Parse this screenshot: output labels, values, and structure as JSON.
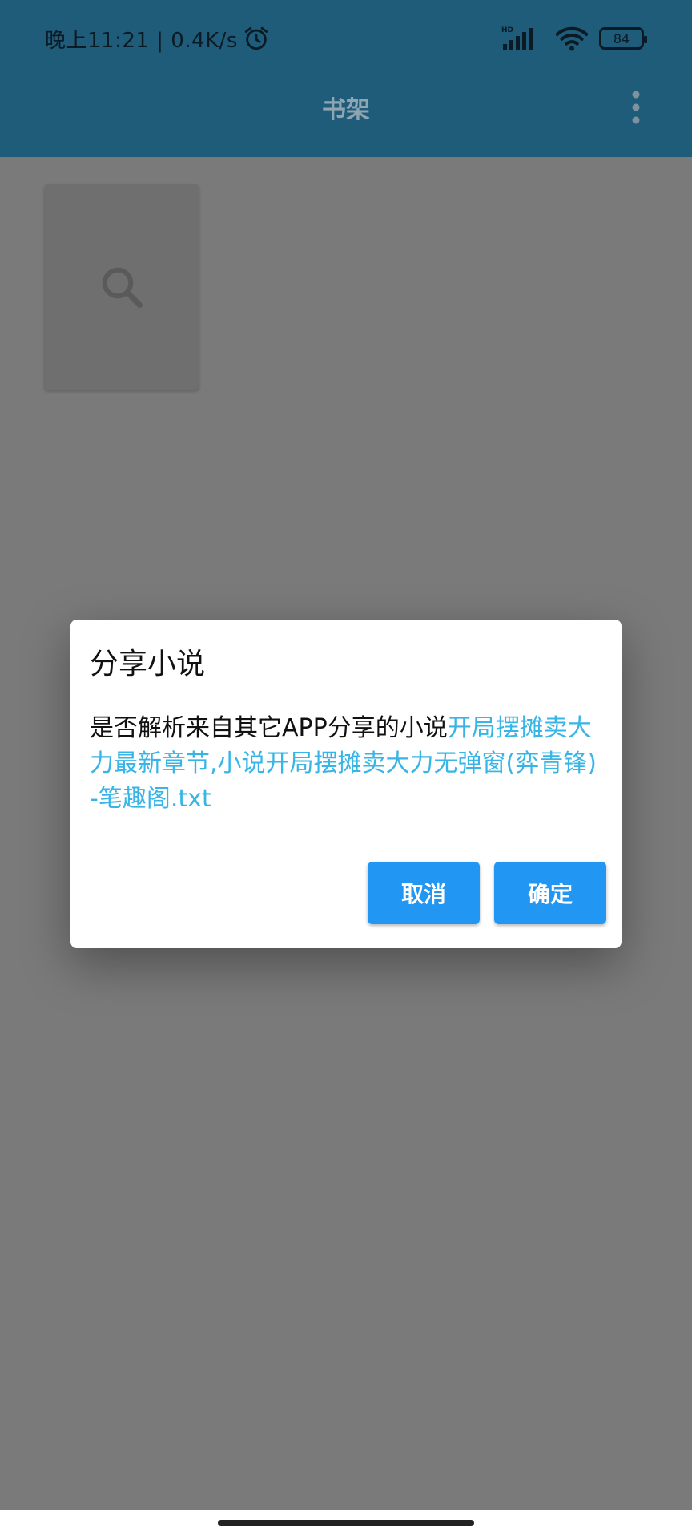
{
  "status_bar": {
    "time_speed": "晚上11:21 | 0.4K/s",
    "battery_level": "84",
    "icons": [
      "alarm-icon",
      "hd-signal-icon",
      "wifi-icon",
      "battery-icon"
    ]
  },
  "app_bar": {
    "title": "书架",
    "menu_icon": "more-vert-icon"
  },
  "bookshelf": {
    "items": [
      {
        "type": "search-placeholder",
        "icon": "search-icon"
      }
    ]
  },
  "dialog": {
    "title": "分享小说",
    "message_prefix": "是否解析来自其它APP分享的小说",
    "message_highlight": "开局摆摊卖大力最新章节,小说开局摆摊卖大力无弹窗(弈青锋)-笔趣阁.txt",
    "cancel_label": "取消",
    "confirm_label": "确定"
  },
  "colors": {
    "appbar_dimmed": "#1f5c7a",
    "scrim_background": "#7a7a7a",
    "dialog_button": "#2196f3",
    "link_highlight": "#36b5e6"
  }
}
